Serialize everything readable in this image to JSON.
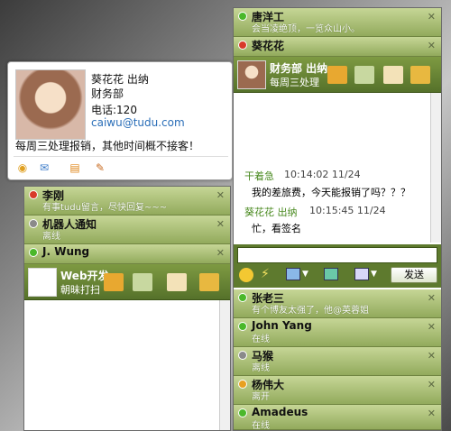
{
  "profile_card": {
    "name_title": "葵花花 出纳",
    "department": "财务部",
    "phone": "电话:120",
    "email": "caiwu@tudu.com",
    "signature": "每周三处理报销，其他时间概不接客！"
  },
  "left_panel": {
    "contacts": [
      {
        "name": "李刚",
        "sub": "有事tudu留言，尽快回复~~~"
      },
      {
        "name": "机器人通知",
        "sub": "离线"
      },
      {
        "name": "J. Wung",
        "sub": ""
      }
    ],
    "expanded": {
      "name": "Web开发",
      "sub": "朝昧打扫"
    }
  },
  "right_panel": {
    "top": {
      "name": "唐洋工",
      "sub": "会当凌绝顶，一览众山小。"
    },
    "chat_header": {
      "name": "葵花花",
      "expanded_name": "财务部 出纳",
      "expanded_sub": "每周三处理"
    },
    "messages": [
      {
        "sender": "干着急",
        "time": "10:14:02 11/24",
        "text": "我的差旅费，今天能报销了吗？？？"
      },
      {
        "sender": "葵花花 出纳",
        "time": "10:15:45 11/24",
        "text": "忙，看签名"
      }
    ],
    "send_label": "发送",
    "contacts": [
      {
        "name": "张老三",
        "sub": "有个博友太强了，他@英蓉姐"
      },
      {
        "name": "John Yang",
        "sub": "在线"
      },
      {
        "name": "马猴",
        "sub": "离线"
      },
      {
        "name": "杨伟大",
        "sub": "离开"
      },
      {
        "name": "Amadeus",
        "sub": "在线"
      }
    ]
  },
  "colors": {
    "online": "#4ab82a",
    "busy": "#d83a2a",
    "away": "#e8a020",
    "offline": "#8a8a8a",
    "title_green": "#6b8a30"
  }
}
